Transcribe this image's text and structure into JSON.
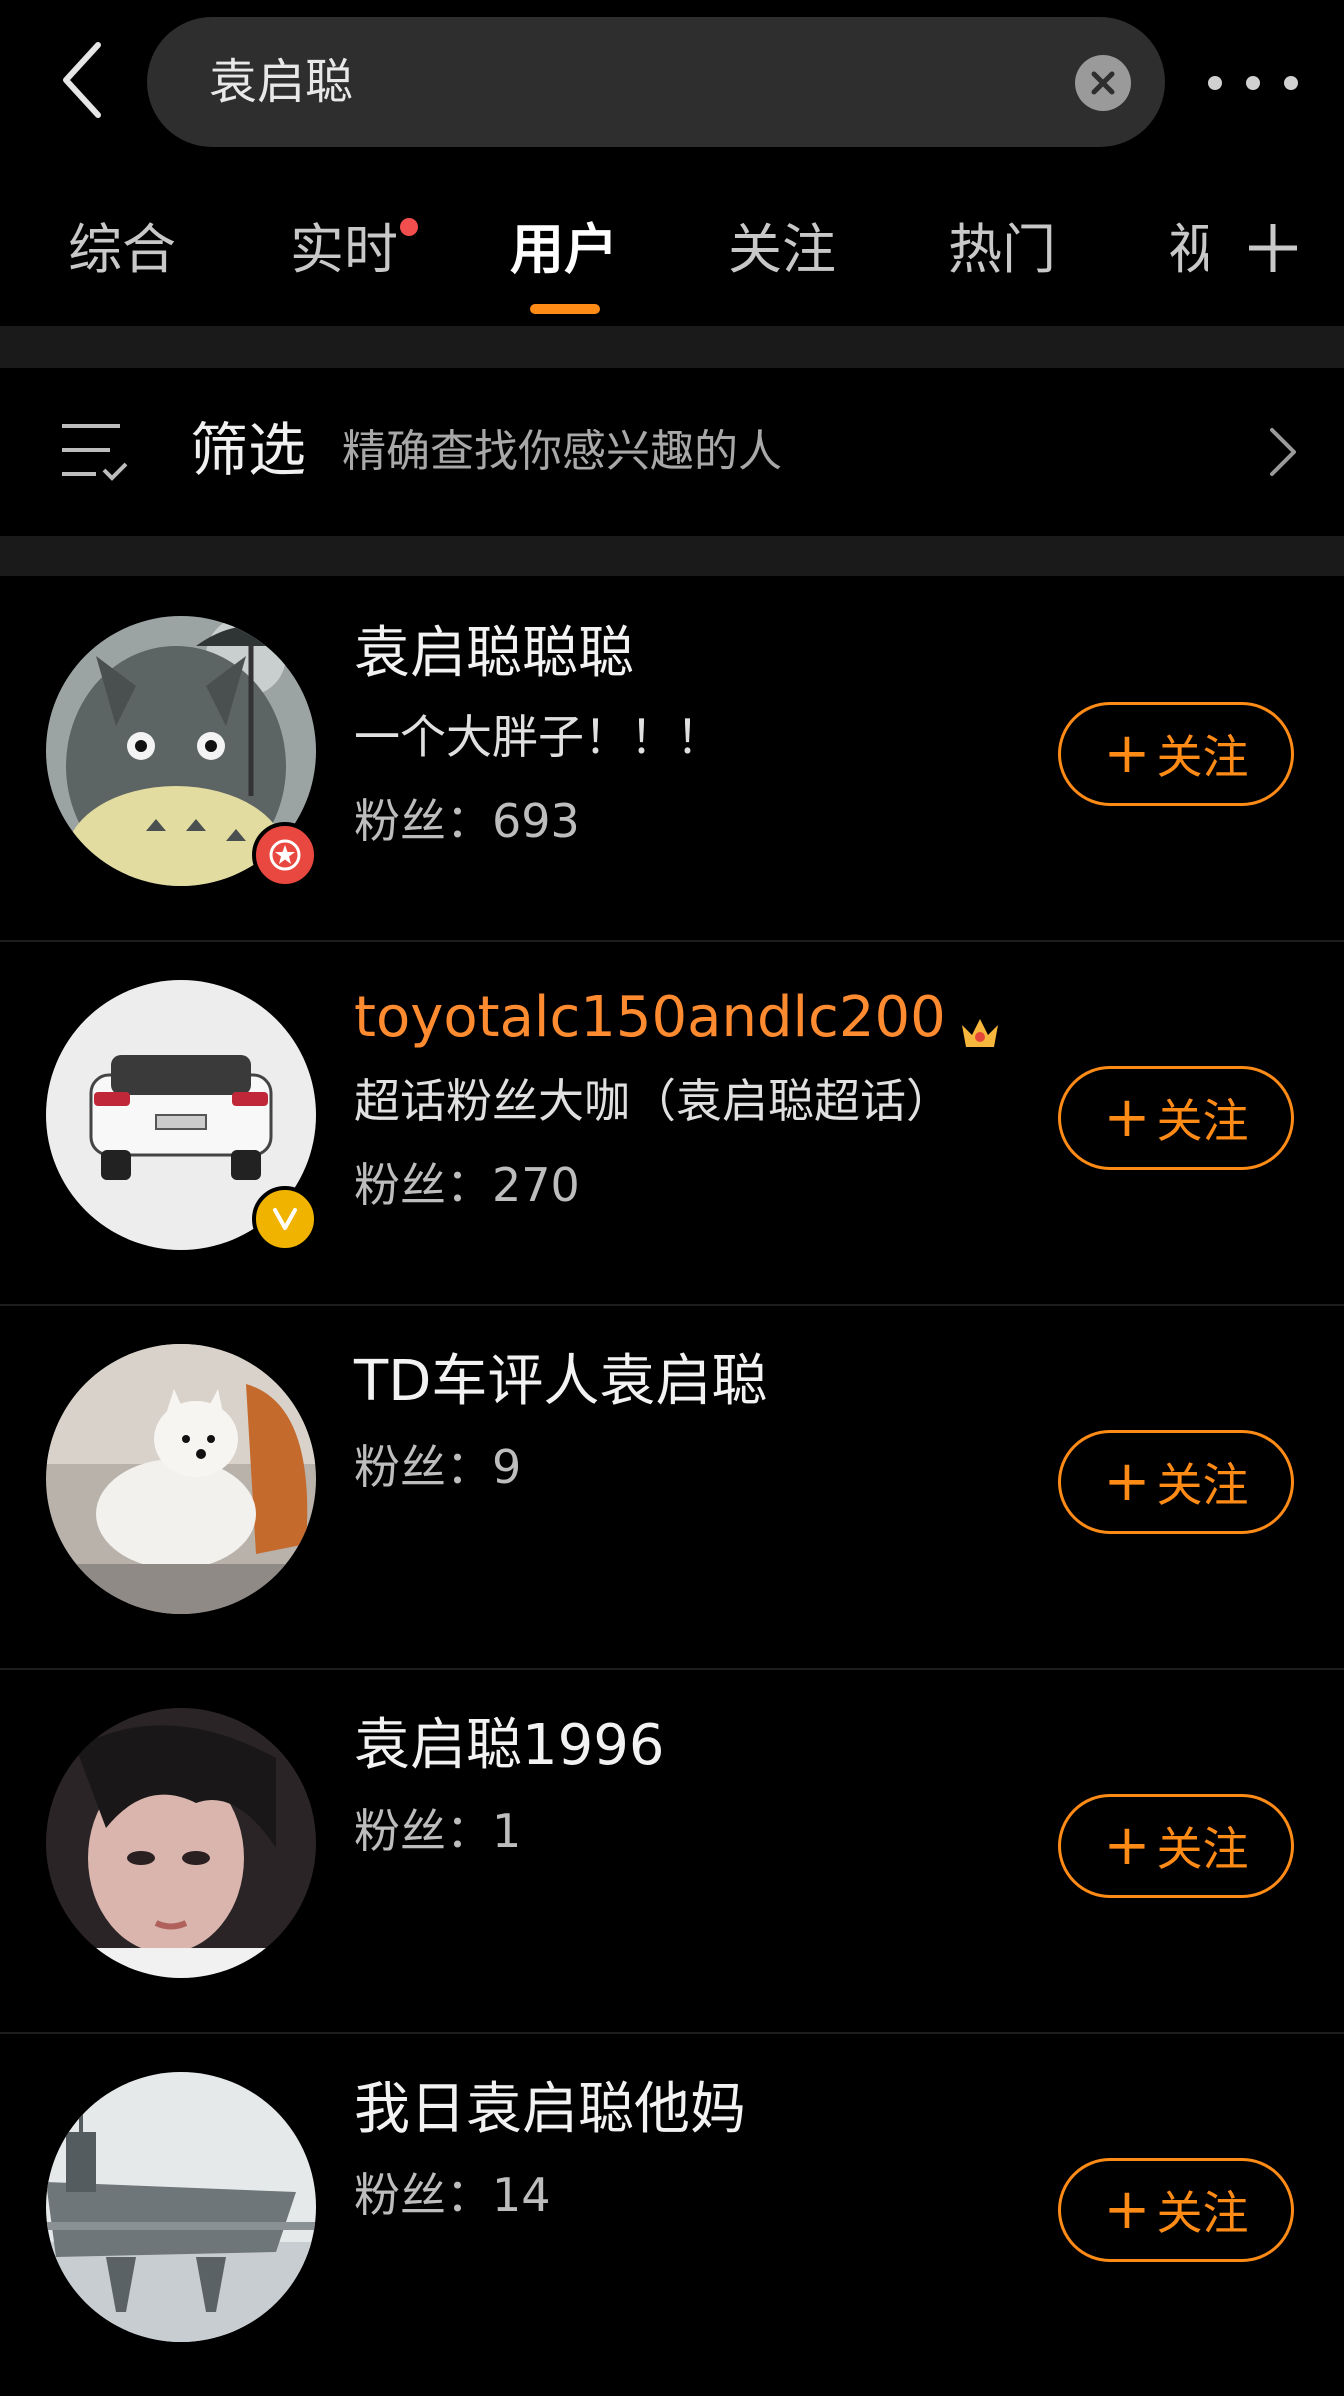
{
  "search": {
    "query": "袁启聪"
  },
  "tabs": [
    {
      "label": "综合"
    },
    {
      "label": "实时"
    },
    {
      "label": "用户"
    },
    {
      "label": "关注"
    },
    {
      "label": "热门"
    },
    {
      "label": "视"
    }
  ],
  "active_tab": "用户",
  "filter": {
    "title": "筛选",
    "description": "精确查找你感兴趣的人"
  },
  "users": [
    {
      "name": "袁启聪聪聪",
      "bio": "一个大胖子！！！",
      "fans": "粉丝：693",
      "follow_label": "关注",
      "badge": "red-star-badge"
    },
    {
      "name": "toyotalc150andlc200",
      "bio": "超话粉丝大咖（袁启聪超话）",
      "fans": "粉丝：270",
      "follow_label": "关注",
      "badge": "yellow-v-badge",
      "name_color": "#ff8b30"
    },
    {
      "name": "TD车评人袁启聪",
      "fans": "粉丝：9",
      "follow_label": "关注"
    },
    {
      "name": "袁启聪1996",
      "fans": "粉丝：1",
      "follow_label": "关注"
    },
    {
      "name": "我日袁启聪他妈",
      "fans": "粉丝：14",
      "follow_label": "关注"
    }
  ],
  "colors": {
    "accent": "#ff8b17",
    "background": "#000000",
    "notify_dot": "#f24e4e"
  },
  "icons": [
    "back-arrow-icon",
    "clear-icon",
    "more-icon",
    "add-tab-icon",
    "filter-icon",
    "chevron-right-icon",
    "crown-icon"
  ]
}
